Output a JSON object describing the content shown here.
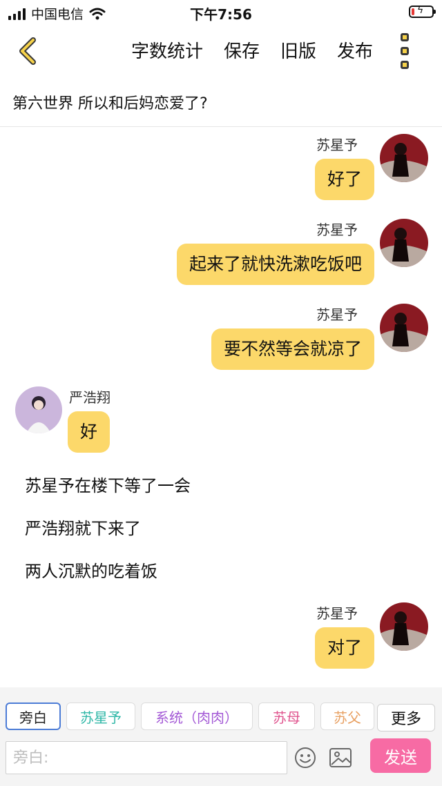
{
  "status_bar": {
    "carrier": "中国电信",
    "time": "下午7:56",
    "battery_level": 0.15
  },
  "header": {
    "actions": [
      "字数统计",
      "保存",
      "旧版",
      "发布"
    ],
    "chapter_title": "第六世界  所以和后妈恋爱了?"
  },
  "messages": [
    {
      "side": "right",
      "name": "苏星予",
      "text": "好了"
    },
    {
      "side": "right",
      "name": "苏星予",
      "text": "起来了就快洗漱吃饭吧"
    },
    {
      "side": "right",
      "name": "苏星予",
      "text": "要不然等会就凉了"
    },
    {
      "side": "left",
      "name": "严浩翔",
      "text": "好"
    },
    {
      "side": "narration",
      "text": "苏星予在楼下等了一会"
    },
    {
      "side": "narration",
      "text": "严浩翔就下来了"
    },
    {
      "side": "narration",
      "text": "两人沉默的吃着饭"
    },
    {
      "side": "right",
      "name": "苏星予",
      "text": "对了"
    }
  ],
  "roles": [
    {
      "label": "旁白",
      "color": "#222222",
      "active": true
    },
    {
      "label": "苏星予",
      "color": "#2fb7a7",
      "active": false
    },
    {
      "label": "系统（肉肉）",
      "color": "#a45ad6",
      "active": false
    },
    {
      "label": "苏母",
      "color": "#e0548e",
      "active": false
    },
    {
      "label": "苏父",
      "color": "#e8a062",
      "active": false
    }
  ],
  "more_label": "更多",
  "input": {
    "placeholder": "旁白:",
    "value": ""
  },
  "send_label": "发送",
  "colors": {
    "bubble": "#fcd86a",
    "send": "#f76ba4",
    "active_chip_border": "#4b7bd6"
  }
}
